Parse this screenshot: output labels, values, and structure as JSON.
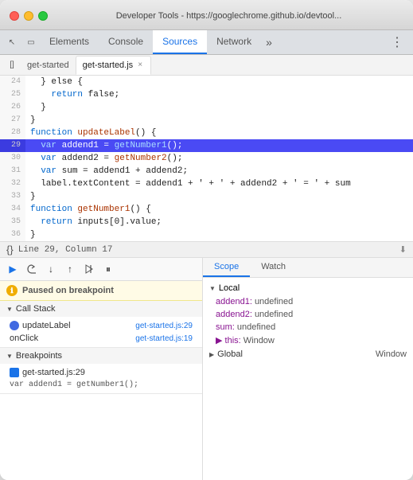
{
  "window": {
    "title": "Developer Tools - https://googlechrome.github.io/devtool..."
  },
  "tabs": {
    "items": [
      {
        "label": "Elements",
        "active": false
      },
      {
        "label": "Console",
        "active": false
      },
      {
        "label": "Sources",
        "active": true
      },
      {
        "label": "Network",
        "active": false
      }
    ],
    "more_label": "»",
    "menu_label": "⋮"
  },
  "file_tabs": {
    "toggle_icon": "[]",
    "items": [
      {
        "label": "get-started",
        "closeable": false,
        "active": false
      },
      {
        "label": "get-started.js",
        "closeable": true,
        "active": true
      }
    ]
  },
  "code": {
    "lines": [
      {
        "num": "24",
        "content": "  } else {",
        "highlighted": false
      },
      {
        "num": "25",
        "content": "    return false;",
        "highlighted": false
      },
      {
        "num": "26",
        "content": "  }",
        "highlighted": false
      },
      {
        "num": "27",
        "content": "}",
        "highlighted": false
      },
      {
        "num": "28",
        "content": "function updateLabel() {",
        "highlighted": false
      },
      {
        "num": "29",
        "content": "  var addend1 = getNumber1();",
        "highlighted": true
      },
      {
        "num": "30",
        "content": "  var addend2 = getNumber2();",
        "highlighted": false
      },
      {
        "num": "31",
        "content": "  var sum = addend1 + addend2;",
        "highlighted": false
      },
      {
        "num": "32",
        "content": "  label.textContent = addend1 + ' + ' + addend2 + ' = ' + sum",
        "highlighted": false
      },
      {
        "num": "33",
        "content": "}",
        "highlighted": false
      },
      {
        "num": "34",
        "content": "function getNumber1() {",
        "highlighted": false
      },
      {
        "num": "35",
        "content": "  return inputs[0].value;",
        "highlighted": false
      },
      {
        "num": "36",
        "content": "}",
        "highlighted": false
      }
    ],
    "cursor_line": "Line 29, Column 17"
  },
  "debugger": {
    "toolbar": [
      {
        "icon": "▶",
        "name": "resume",
        "label": "Resume",
        "active": true
      },
      {
        "icon": "↺",
        "name": "step-over",
        "label": "Step over"
      },
      {
        "icon": "↓",
        "name": "step-into",
        "label": "Step into"
      },
      {
        "icon": "↑",
        "name": "step-out",
        "label": "Step out"
      },
      {
        "icon": "⇥",
        "name": "step",
        "label": "Step"
      },
      {
        "icon": "⏸",
        "name": "pause",
        "label": "Pause on exceptions"
      }
    ],
    "paused_text": "Paused on breakpoint",
    "call_stack": {
      "title": "Call Stack",
      "items": [
        {
          "fn": "updateLabel",
          "file": "get-started.js:29"
        },
        {
          "fn": "onClick",
          "file": "get-started.js:19"
        }
      ]
    },
    "breakpoints": {
      "title": "Breakpoints",
      "items": [
        {
          "label": "get-started.js:29",
          "code": "var addend1 = getNumber1();"
        }
      ]
    }
  },
  "scope": {
    "tabs": [
      {
        "label": "Scope",
        "active": true
      },
      {
        "label": "Watch",
        "active": false
      }
    ],
    "local": {
      "title": "Local",
      "vars": [
        {
          "prop": "addend1:",
          "val": "undefined"
        },
        {
          "prop": "addend2:",
          "val": "undefined"
        },
        {
          "prop": "sum:",
          "val": "undefined"
        },
        {
          "prop": "▶ this:",
          "val": "Window"
        }
      ]
    },
    "global": {
      "title": "Global",
      "val": "Window"
    }
  }
}
